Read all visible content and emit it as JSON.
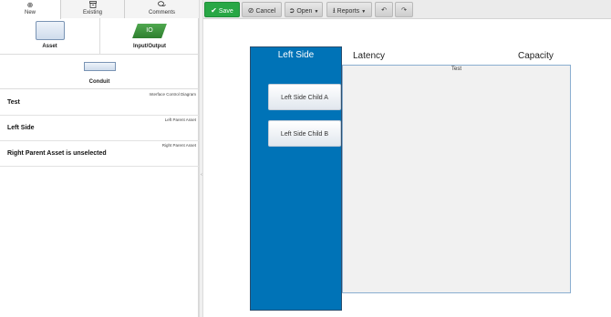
{
  "tabs": [
    {
      "label": "New",
      "icon": "plus-circle-icon",
      "active": true
    },
    {
      "label": "Existing",
      "icon": "archive-icon",
      "active": false
    },
    {
      "label": "Comments",
      "icon": "comments-icon",
      "active": false
    }
  ],
  "palette": {
    "asset_label": "Asset",
    "io_label": "Input/Output",
    "io_shape_text": "IO",
    "conduit_label": "Conduit"
  },
  "properties": [
    {
      "type": "Interface Control Diagram",
      "value": "Test"
    },
    {
      "type": "Left Parent Asset",
      "value": "Left Side"
    },
    {
      "type": "Right Parent Asset",
      "value": "Right Parent Asset is unselected"
    }
  ],
  "toolbar": {
    "save": "Save",
    "cancel": "Cancel",
    "open": "Open",
    "reports": "Reports",
    "save_color": "#28a745"
  },
  "diagram": {
    "left_side_title": "Left Side",
    "children": [
      "Left Side Child A",
      "Left Side Child B"
    ],
    "icd_name": "Test",
    "column_headers": [
      "Latency",
      "Capacity"
    ],
    "left_side_color": "#0073b7"
  }
}
